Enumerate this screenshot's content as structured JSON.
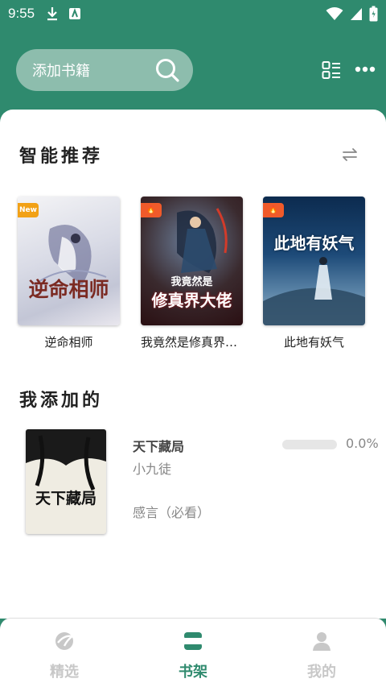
{
  "status_bar": {
    "time": "9:55"
  },
  "header": {
    "search_placeholder": "添加书籍"
  },
  "recommend": {
    "title": "智能推荐",
    "books": [
      {
        "title": "逆命相师",
        "cover_text": "逆命相师",
        "badge": "New",
        "badge_color": "#f2a116"
      },
      {
        "title": "我竟然是修真界大佬",
        "cover_text": "修真界大佬",
        "cover_subtext": "我竟然是",
        "badge": "🔥",
        "badge_color": "#f05a2a"
      },
      {
        "title": "此地有妖气",
        "cover_text": "此地有妖气",
        "badge": "🔥",
        "badge_color": "#f05a2a"
      }
    ]
  },
  "added": {
    "title": "我添加的",
    "book": {
      "title": "天下藏局",
      "cover_text": "天下藏局",
      "author": "小九徒",
      "progress": "0.0%",
      "progress_value": 0,
      "note": "感言（必看）"
    }
  },
  "nav": {
    "items": [
      {
        "label": "精选",
        "active": false
      },
      {
        "label": "书架",
        "active": true
      },
      {
        "label": "我的",
        "active": false
      }
    ],
    "active_color": "#2f8a6e",
    "inactive_color": "#c8c8c8"
  }
}
